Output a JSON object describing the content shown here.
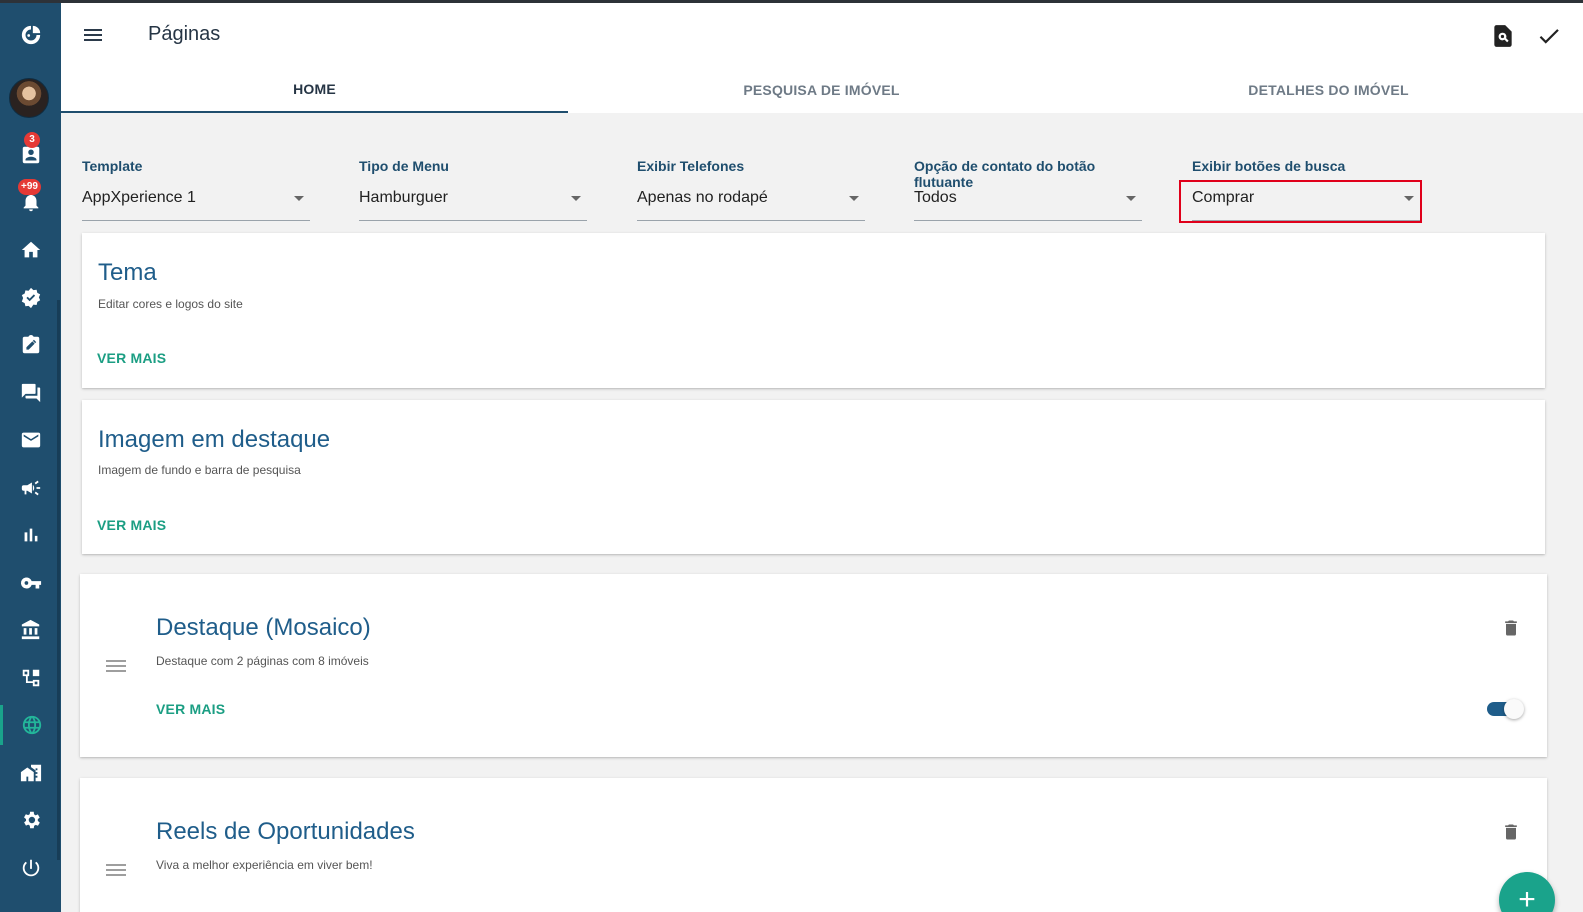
{
  "header": {
    "title": "Páginas",
    "menu_icon": "menu-icon",
    "preview_icon": "preview-search-icon",
    "confirm_icon": "check-icon"
  },
  "tabs": [
    {
      "label": "HOME",
      "active": true
    },
    {
      "label": "PESQUISA DE IMÓVEL",
      "active": false
    },
    {
      "label": "DETALHES DO IMÓVEL",
      "active": false
    }
  ],
  "sidebar": {
    "badges": {
      "contacts": "3",
      "notifications": "+99"
    },
    "items": [
      "logo-icon",
      "avatar",
      "contacts-icon",
      "notifications-icon",
      "home-icon",
      "verified-icon",
      "edit-note-icon",
      "chat-icon",
      "mail-icon",
      "megaphone-icon",
      "chart-icon",
      "key-icon",
      "bank-icon",
      "hierarchy-icon",
      "globe-icon",
      "buildings-icon",
      "settings-icon",
      "power-icon"
    ],
    "active_item": "globe-icon"
  },
  "fields": [
    {
      "label": "Template",
      "value": "AppXperience 1"
    },
    {
      "label": "Tipo de Menu",
      "value": "Hamburguer"
    },
    {
      "label": "Exibir Telefones",
      "value": "Apenas no rodapé"
    },
    {
      "label": "Opção de contato do botão flutuante",
      "value": "Todos"
    },
    {
      "label": "Exibir botões de busca",
      "value": "Comprar"
    }
  ],
  "cards": [
    {
      "title": "Tema",
      "subtitle": "Editar cores e logos do site",
      "link": "VER MAIS"
    },
    {
      "title": "Imagem em destaque",
      "subtitle": "Imagem de fundo e barra de pesquisa",
      "link": "VER MAIS"
    },
    {
      "title": "Destaque (Mosaico)",
      "subtitle": "Destaque com 2 páginas com 8 imóveis",
      "link": "VER MAIS",
      "enabled": true
    },
    {
      "title": "Reels de Oportunidades",
      "subtitle": "Viva a melhor experiência em viver bem!"
    }
  ],
  "fab": {
    "label": "+"
  },
  "colors": {
    "sidebar": "#1f4e6e",
    "accent": "#1aa38b",
    "title": "#1f5d8a",
    "highlight": "#e0001b"
  }
}
